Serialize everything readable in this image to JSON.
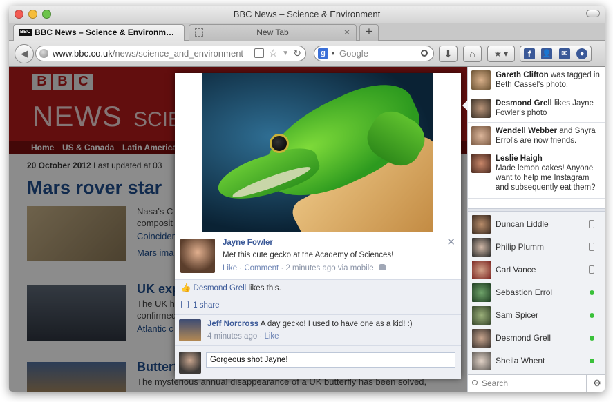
{
  "window": {
    "title": "BBC News – Science & Environment"
  },
  "tabs": [
    {
      "label": "BBC News – Science & Environm…",
      "favicon": "BBC",
      "active": true
    },
    {
      "label": "New Tab",
      "active": false
    }
  ],
  "address_bar": {
    "url_host": "www.bbc.co.uk",
    "url_path": "/news/science_and_environment"
  },
  "search_bar": {
    "placeholder": "Google"
  },
  "page": {
    "logo_letters": [
      "B",
      "B",
      "C"
    ],
    "section_heading": "NEWS",
    "section_subheading": "SCIE",
    "nav": [
      "Home",
      "US & Canada",
      "Latin America"
    ],
    "dateline_date": "20 October 2012",
    "dateline_updated": "Last updated at 03",
    "headline": "Mars rover star",
    "stories": [
      {
        "lines": [
          "Nasa's C",
          "composit"
        ],
        "link": "Coinciden",
        "link2": "Mars ima"
      },
      {
        "title": "UK exp",
        "lines": [
          "The UK h",
          "confirmed"
        ],
        "link": "Atlantic c"
      },
      {
        "title": "Butterf",
        "lines": [
          "The mysterious annual disappearance of a UK butterfly has been solved,"
        ]
      }
    ]
  },
  "popup": {
    "post": {
      "author": "Jayne Fowler",
      "message": "Met this cute gecko at the Academy of Sciences!",
      "like_label": "Like",
      "comment_label": "Comment",
      "time": "2 minutes ago via mobile"
    },
    "likes": {
      "name": "Desmond Grell",
      "text": "likes this."
    },
    "shares": "1 share",
    "comment": {
      "author": "Jeff Norcross",
      "text": "A day gecko! I used to have one as a kid! :)",
      "time": "4 minutes ago",
      "like_label": "Like"
    },
    "reply_value": "Gorgeous shot Jayne!"
  },
  "ticker": [
    {
      "name": "Gareth Clifton",
      "text": "was tagged in Beth Cassel's photo."
    },
    {
      "name": "Desmond Grell",
      "text": "likes Jayne Fowler's photo"
    },
    {
      "name": "Wendell Webber",
      "text": "and Shyra Errol's are now friends."
    },
    {
      "name": "Leslie Haigh",
      "text": "Made lemon cakes! Anyone want to help me Instagram and subsequently eat them?"
    }
  ],
  "chat": [
    {
      "name": "Duncan Liddle",
      "status": "mobile"
    },
    {
      "name": "Philip Plumm",
      "status": "mobile"
    },
    {
      "name": "Carl Vance",
      "status": "mobile"
    },
    {
      "name": "Sebastion Errol",
      "status": "online"
    },
    {
      "name": "Sam Spicer",
      "status": "online"
    },
    {
      "name": "Desmond Grell",
      "status": "online"
    },
    {
      "name": "Sheila Whent",
      "status": "online"
    }
  ],
  "chat_search": {
    "placeholder": "Search"
  },
  "colors": {
    "bbc_red": "#b21a1a",
    "facebook_blue": "#3b5998",
    "online_green": "#3ac13a"
  }
}
